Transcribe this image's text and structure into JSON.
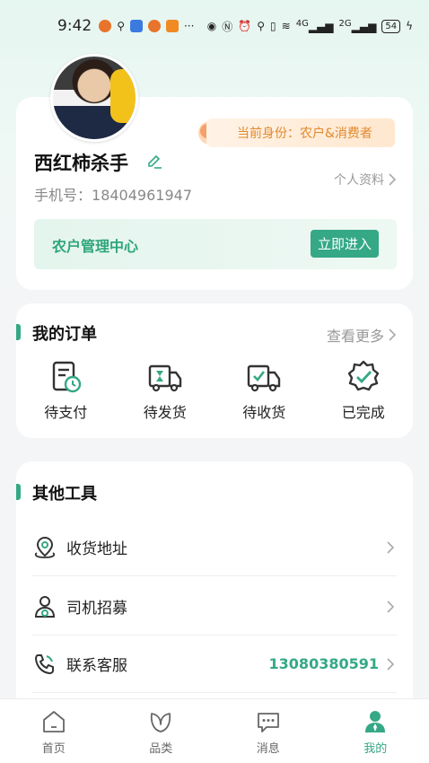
{
  "status_bar": {
    "time": "9:42",
    "extra": "···",
    "network_1": "4G",
    "network_2": "2G",
    "battery": "54"
  },
  "profile": {
    "identity_badge": "当前身份：农户&消费者",
    "username": "西红柿杀手",
    "phone_label": "手机号：",
    "phone": "18404961947",
    "profile_link": "个人资料",
    "farm_center": "农户管理中心",
    "farm_enter": "立即进入"
  },
  "orders": {
    "title": "我的订单",
    "see_more": "查看更多",
    "items": [
      {
        "label": "待支付",
        "icon": "pending-payment-icon"
      },
      {
        "label": "待发货",
        "icon": "pending-shipment-icon"
      },
      {
        "label": "待收货",
        "icon": "pending-receipt-icon"
      },
      {
        "label": "已完成",
        "icon": "completed-icon"
      }
    ]
  },
  "tools": {
    "title": "其他工具",
    "items": [
      {
        "label": "收货地址",
        "icon": "location-icon",
        "value": ""
      },
      {
        "label": "司机招募",
        "icon": "driver-icon",
        "value": ""
      },
      {
        "label": "联系客服",
        "icon": "phone-icon",
        "value": "13080380591"
      }
    ]
  },
  "tabbar": {
    "items": [
      {
        "label": "首页",
        "icon": "home-icon"
      },
      {
        "label": "品类",
        "icon": "leaf-icon"
      },
      {
        "label": "消息",
        "icon": "message-icon"
      },
      {
        "label": "我的",
        "icon": "user-icon"
      }
    ],
    "active_index": 3
  },
  "colors": {
    "accent": "#35a886",
    "badge_text": "#e08a2d"
  }
}
